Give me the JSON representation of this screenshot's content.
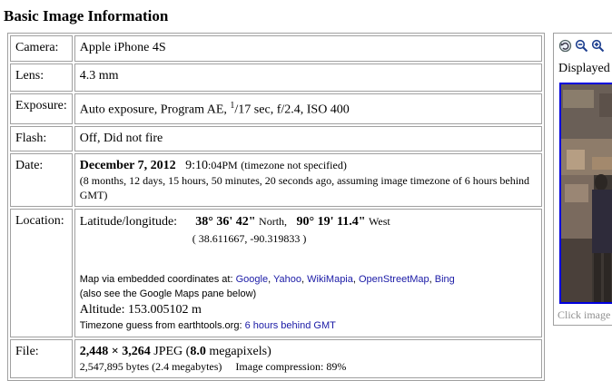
{
  "title": "Basic Image Information",
  "camera": {
    "label": "Camera:",
    "value": "Apple iPhone 4S"
  },
  "lens": {
    "label": "Lens:",
    "value": "4.3 mm"
  },
  "exposure": {
    "label": "Exposure:",
    "prefix": "Auto exposure, Program AE,",
    "num": "1",
    "den": "/17 sec, f/2.4, ISO 400"
  },
  "flash": {
    "label": "Flash:",
    "value": "Off, Did not fire"
  },
  "date": {
    "label": "Date:",
    "date_bold": "December 7, 2012",
    "time_main": "9:10",
    "time_small": ":04PM",
    "tz_note": "(timezone not specified)",
    "ago": "(8 months, 12 days, 15 hours, 50 minutes, 20 seconds ago, assuming image timezone of 6 hours behind GMT)"
  },
  "location": {
    "label": "Location:",
    "latlon_label": "Latitude/longitude:",
    "lat": "38° 36' 42\"",
    "lat_dir": "North,",
    "lon": "90° 19' 11.4\"",
    "lon_dir": "West",
    "decimal_open": "(",
    "decimal": "38.611667, -90.319833",
    "decimal_close": ")",
    "map_via": "Map via embedded coordinates at:",
    "map_links": [
      "Google",
      "Yahoo",
      "WikiMapia",
      "OpenStreetMap",
      "Bing"
    ],
    "see_also": "(also see the Google Maps pane below)",
    "altitude": "Altitude: 153.005102 m",
    "tz_guess_prefix": "Timezone guess from earthtools.org:",
    "tz_guess_link": "6 hours behind GMT"
  },
  "file": {
    "label": "File:",
    "dims": "2,448 × 3,264",
    "format": "JPEG",
    "mp_open": "(",
    "mp": "8.0",
    "mp_unit": "megapixels)",
    "bytes": "2,547,895 bytes (2.4 megabytes)",
    "compression": "Image compression: 89%"
  },
  "side": {
    "displayed": "Displayed",
    "click": "Click image"
  },
  "colors": {
    "link": "#1a1aa6",
    "thumb_border": "#0000dd",
    "border": "#a0a0a0"
  }
}
